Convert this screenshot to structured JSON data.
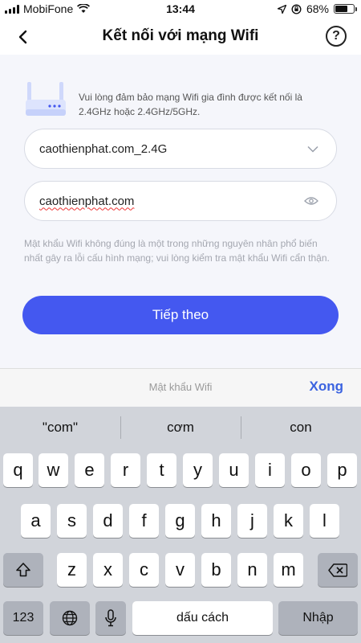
{
  "status_bar": {
    "carrier": "MobiFone",
    "time": "13:44",
    "battery_percent": "68%",
    "battery_level": 0.68
  },
  "header": {
    "title": "Kết nối với mạng Wifi",
    "help_label": "?"
  },
  "content": {
    "info_text": "Vui lòng đảm bảo mạng Wifi gia đình được kết nối là 2.4GHz hoặc 2.4GHz/5GHz.",
    "ssid_value": "caothienphat.com_2.4G",
    "password_value": "caothienphat.com",
    "hint_text": "Mật khẩu Wifi không đúng là một trong những nguyên nhân phổ biến nhất gây ra lỗi cấu hình mạng; vui lòng kiểm tra mật khẩu Wifi cẩn thận.",
    "next_button": "Tiếp theo"
  },
  "accessory_bar": {
    "field_label": "Mật khẩu Wifi",
    "done_button": "Xong"
  },
  "keyboard": {
    "suggestions": [
      "\"com\"",
      "cơm",
      "con"
    ],
    "row1": [
      "q",
      "w",
      "e",
      "r",
      "t",
      "y",
      "u",
      "i",
      "o",
      "p"
    ],
    "row2": [
      "a",
      "s",
      "d",
      "f",
      "g",
      "h",
      "j",
      "k",
      "l"
    ],
    "row3": [
      "z",
      "x",
      "c",
      "v",
      "b",
      "n",
      "m"
    ],
    "numbers_key": "123",
    "space_key": "dấu cách",
    "return_key": "Nhập"
  }
}
